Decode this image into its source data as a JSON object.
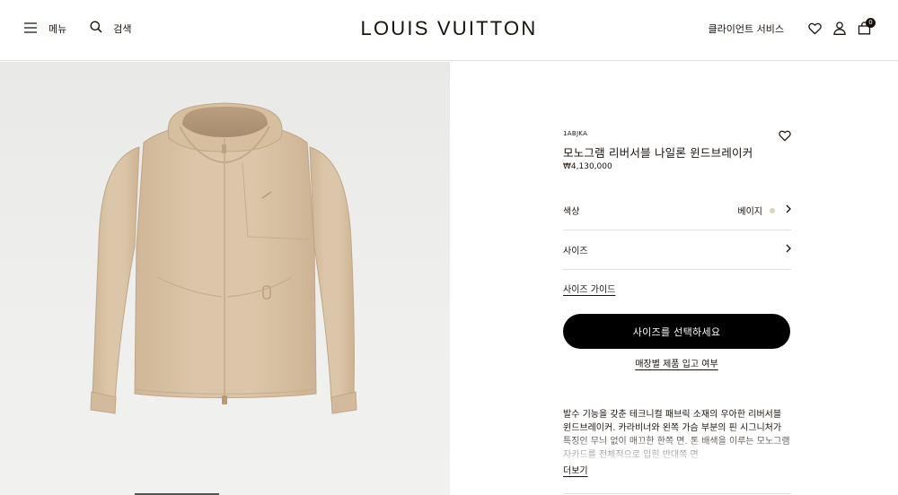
{
  "header": {
    "menu_label": "메뉴",
    "search_label": "검색",
    "logo": "LOUIS VUITTON",
    "client_service": "클라이언트 서비스",
    "cart_count": "0"
  },
  "product": {
    "sku": "1ABJKA",
    "name": "모노그램 리버서블 나일론 윈드브레이커",
    "price": "₩4,130,000",
    "color_label": "색상",
    "color_value": "베이지",
    "color_swatch": "#e4d0b7",
    "size_label": "사이즈",
    "size_guide": "사이즈 가이드",
    "cta_label": "사이즈를 선택하세요",
    "store_stock": "매장별 제품 입고 여부",
    "description": "발수 기능을 갖춘 테크니컬 패브릭 소재의 우아한 리버서블 윈드브레이커. 카라비너와 왼쪽 가슴 부분의 핀 시그니처가 특징인 무늬 없이 매끄한 한쪽 면. 톤 배색을 이루는 모노그램 자카드를 전체적으로 입힌 반대쪽 면",
    "more_label": "더보기"
  },
  "colors": {
    "text": "#19110b",
    "cta_bg": "#000000",
    "divider": "#e1e1e1",
    "jacket": "#d9c2a5"
  }
}
